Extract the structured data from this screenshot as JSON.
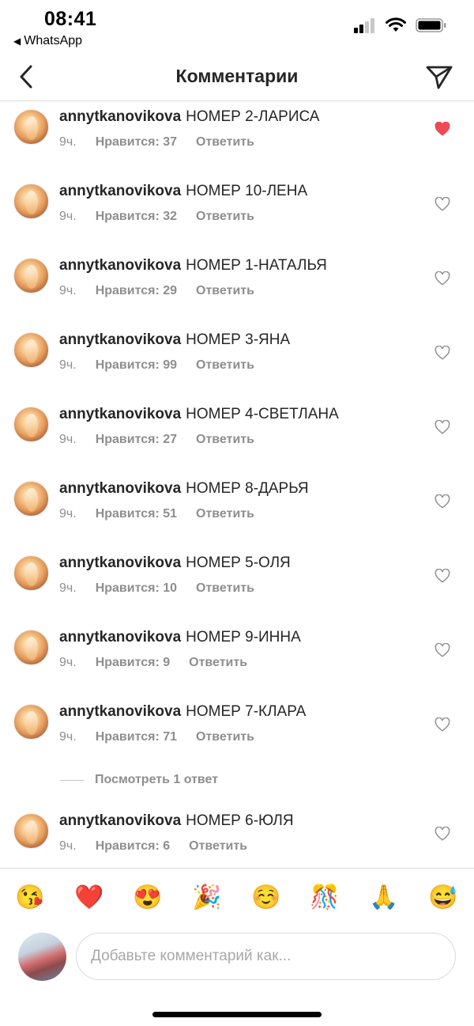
{
  "status_bar": {
    "time": "08:41",
    "back_app": "WhatsApp"
  },
  "header": {
    "title": "Комментарии"
  },
  "comments": [
    {
      "user": "annytkanovikova",
      "text": "НОМЕР 2-ЛАРИСА",
      "time": "9ч.",
      "likes": "Нравится: 37",
      "reply": "Ответить",
      "liked": true
    },
    {
      "user": "annytkanovikova",
      "text": "НОМЕР 10-ЛЕНА",
      "time": "9ч.",
      "likes": "Нравится: 32",
      "reply": "Ответить",
      "liked": false
    },
    {
      "user": "annytkanovikova",
      "text": "НОМЕР 1-НАТАЛЬЯ",
      "time": "9ч.",
      "likes": "Нравится: 29",
      "reply": "Ответить",
      "liked": false
    },
    {
      "user": "annytkanovikova",
      "text": "НОМЕР 3-ЯНА",
      "time": "9ч.",
      "likes": "Нравится: 99",
      "reply": "Ответить",
      "liked": false
    },
    {
      "user": "annytkanovikova",
      "text": "НОМЕР 4-СВЕТЛАНА",
      "time": "9ч.",
      "likes": "Нравится: 27",
      "reply": "Ответить",
      "liked": false
    },
    {
      "user": "annytkanovikova",
      "text": "НОМЕР 8-ДАРЬЯ",
      "time": "9ч.",
      "likes": "Нравится: 51",
      "reply": "Ответить",
      "liked": false
    },
    {
      "user": "annytkanovikova",
      "text": "НОМЕР 5-ОЛЯ",
      "time": "9ч.",
      "likes": "Нравится: 10",
      "reply": "Ответить",
      "liked": false
    },
    {
      "user": "annytkanovikova",
      "text": "НОМЕР 9-ИННА",
      "time": "9ч.",
      "likes": "Нравится: 9",
      "reply": "Ответить",
      "liked": false
    },
    {
      "user": "annytkanovikova",
      "text": "НОМЕР 7-КЛАРА",
      "time": "9ч.",
      "likes": "Нравится: 71",
      "reply": "Ответить",
      "liked": false
    },
    {
      "user": "annytkanovikova",
      "text": "НОМЕР 6-ЮЛЯ",
      "time": "9ч.",
      "likes": "Нравится: 6",
      "reply": "Ответить",
      "liked": false
    }
  ],
  "view_replies": "Посмотреть 1 ответ",
  "emoji_bar": [
    "😘",
    "❤️",
    "😍",
    "🎉",
    "☺️",
    "🎊",
    "🙏",
    "😅"
  ],
  "composer": {
    "placeholder": "Добавьте комментарий как..."
  },
  "colors": {
    "liked_heart": "#ed4956",
    "muted_text": "#8e8e8e",
    "primary_text": "#262626"
  }
}
